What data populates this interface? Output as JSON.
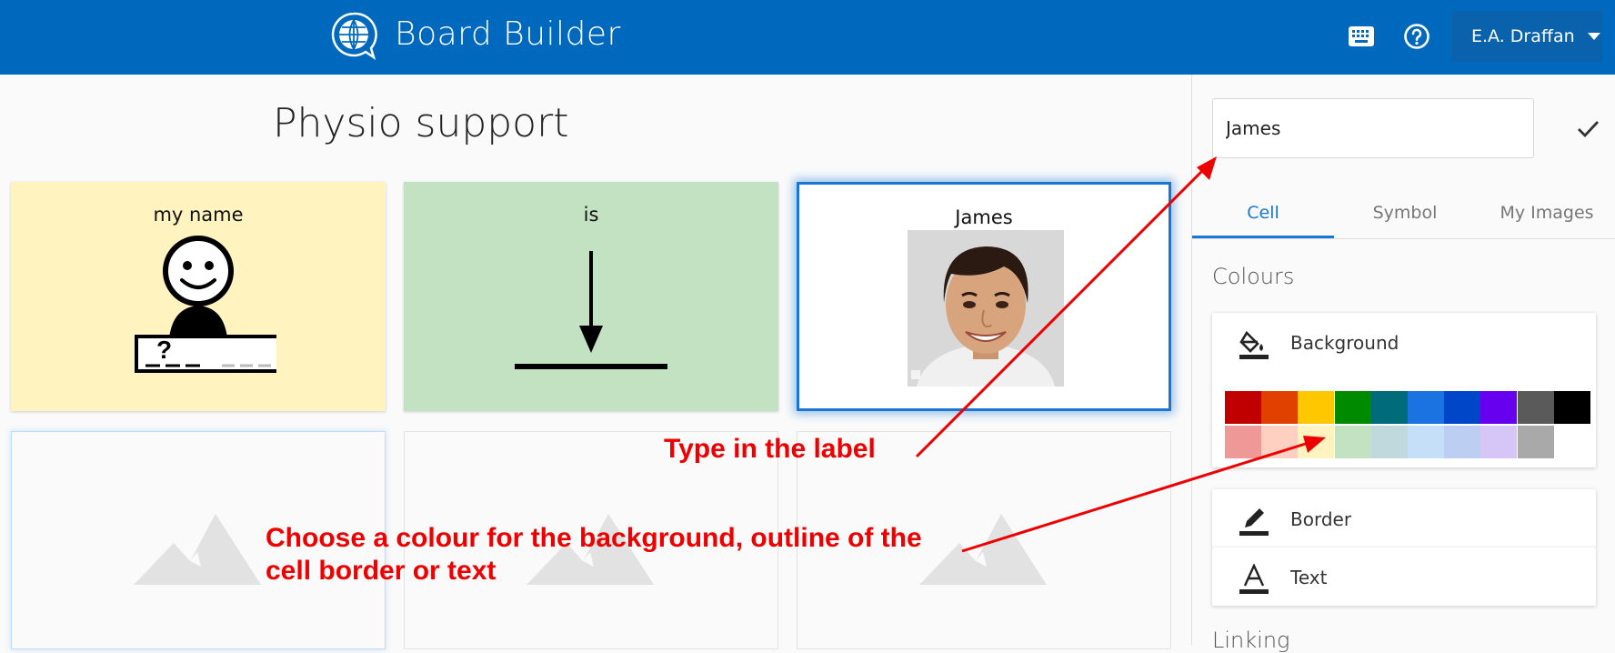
{
  "header": {
    "app_title": "Board Builder",
    "user_name": "E.A. Draffan",
    "icons": [
      "globe-logo-icon",
      "keyboard-icon",
      "help-icon",
      "chevron-down-icon"
    ]
  },
  "board": {
    "title": "Physio support",
    "cells": [
      {
        "label": "my name",
        "background": "#fff3bf",
        "symbol": "person-with-name-sign"
      },
      {
        "label": "is",
        "background": "#c3e2c2",
        "symbol": "arrow-down-to-line"
      },
      {
        "label": "James",
        "background": "#ffffff",
        "symbol": "photo-of-man",
        "selected": true
      }
    ]
  },
  "sidebar": {
    "label_value": "James",
    "tabs": [
      "Cell",
      "Symbol",
      "My Images"
    ],
    "active_tab": "Cell",
    "colours_title": "Colours",
    "background_label": "Background",
    "border_label": "Border",
    "text_label": "Text",
    "linking_title": "Linking",
    "palette_row1": [
      "#c00000",
      "#e04000",
      "#ffc700",
      "#008a00",
      "#006c7a",
      "#1a73e0",
      "#0046c8",
      "#6600ee",
      "#5a5a5a",
      "#000000"
    ],
    "palette_row2": [
      "#ee9898",
      "#fdd0c2",
      "#fff3bf",
      "#c3e2c2",
      "#bfd9dc",
      "#c4dff7",
      "#bccff3",
      "#d6c6f7",
      "#a9a9a9",
      "#ffffff"
    ]
  },
  "annotations": {
    "label_hint": "Type in the label",
    "colour_hint_line1": "Choose a colour for the background, outline of the",
    "colour_hint_line2": "cell border or text"
  }
}
